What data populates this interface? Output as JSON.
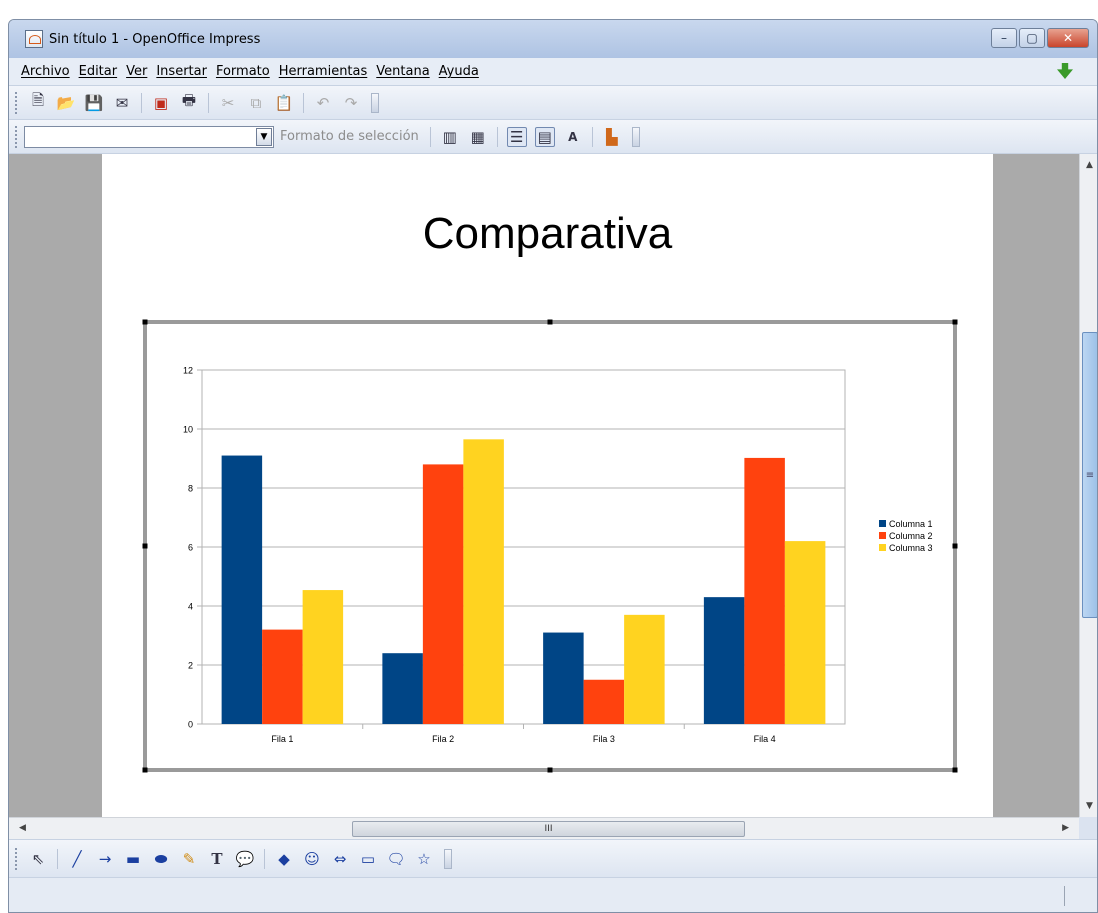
{
  "window": {
    "title": "Sin título 1 - OpenOffice Impress",
    "controls": {
      "minimize": "–",
      "maximize": "▢",
      "close": "✕"
    }
  },
  "menubar": {
    "items": [
      "Archivo",
      "Editar",
      "Ver",
      "Insertar",
      "Formato",
      "Herramientas",
      "Ventana",
      "Ayuda"
    ]
  },
  "toolbar1": {
    "icons": [
      "new-icon",
      "open-icon",
      "save-icon",
      "email-icon",
      "pdf-icon",
      "print-icon",
      "cut-icon",
      "copy-icon",
      "paste-icon",
      "undo-icon",
      "redo-icon"
    ]
  },
  "toolbar2": {
    "selection_combo_value": "",
    "format_selection_label": "Formato de selección"
  },
  "slide": {
    "title": "Comparativa"
  },
  "chart_data": {
    "type": "bar",
    "categories": [
      "Fila 1",
      "Fila 2",
      "Fila 3",
      "Fila 4"
    ],
    "series": [
      {
        "name": "Columna 1",
        "color": "#004586",
        "values": [
          9.1,
          2.4,
          3.1,
          4.3
        ]
      },
      {
        "name": "Columna 2",
        "color": "#ff420e",
        "values": [
          3.2,
          8.8,
          1.5,
          9.02
        ]
      },
      {
        "name": "Columna 3",
        "color": "#ffd320",
        "values": [
          4.54,
          9.65,
          3.7,
          6.2
        ]
      }
    ],
    "title": "",
    "xlabel": "",
    "ylabel": "",
    "ylim": [
      0,
      12
    ],
    "yticks": [
      "0",
      "2",
      "4",
      "6",
      "8",
      "10",
      "12"
    ],
    "grid": true,
    "legend": "right"
  },
  "scroll": {
    "h_thumb_label": "III",
    "v_thumb_label": "≡"
  },
  "drawbar": {
    "icons": [
      "select-icon",
      "line-icon",
      "arrow-line-icon",
      "rectangle-icon",
      "ellipse-icon",
      "freeform-icon",
      "text-icon",
      "callout-icon",
      "basic-shapes-icon",
      "symbol-shapes-icon",
      "block-arrows-icon",
      "flowchart-icon",
      "callouts-icon",
      "stars-icon"
    ]
  }
}
